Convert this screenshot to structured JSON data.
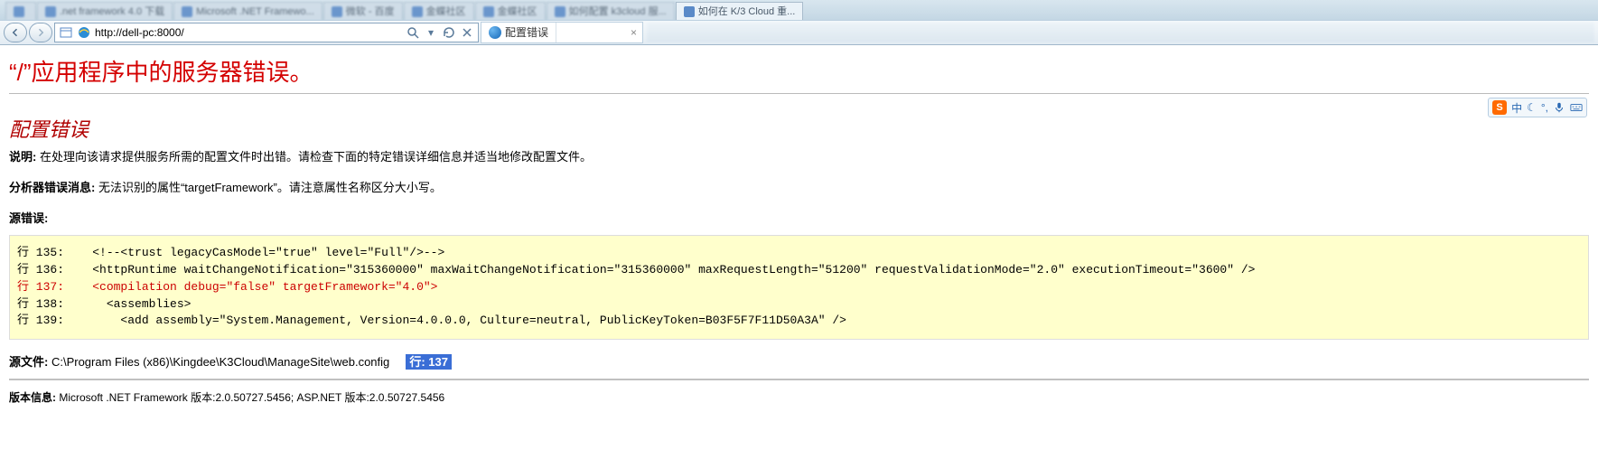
{
  "browser": {
    "tabs": [
      {
        "label": ""
      },
      {
        "label": ".net framework 4.0 下载"
      },
      {
        "label": "Microsoft .NET Framewo..."
      },
      {
        "label": "微软 - 百度"
      },
      {
        "label": "金蝶社区"
      },
      {
        "label": "金蝶社区"
      },
      {
        "label": "如何配置 k3cloud 服..."
      },
      {
        "label": "如何在 K/3 Cloud 重..."
      }
    ],
    "address": "http://dell-pc:8000/",
    "doc_tab_title": "配置错误"
  },
  "ime": {
    "logo": "S",
    "lang": "中",
    "moon": "☾",
    "punct": "°,",
    "mic": "mic",
    "kbd": "kbd"
  },
  "error": {
    "app_title": "“/”应用程序中的服务器错误。",
    "cfg_title": "配置错误",
    "desc_label": "说明:",
    "desc_text": " 在处理向该请求提供服务所需的配置文件时出错。请检查下面的特定错误详细信息并适当地修改配置文件。",
    "parser_label": "分析器错误消息:",
    "parser_text": " 无法识别的属性“targetFramework”。请注意属性名称区分大小写。",
    "src_err_label": "源错误:",
    "code": {
      "l135_prefix": "行 135:    ",
      "l135": "<!--<trust legacyCasModel=\"true\" level=\"Full\"/>-->",
      "l136_prefix": "行 136:    ",
      "l136": "<httpRuntime waitChangeNotification=\"315360000\" maxWaitChangeNotification=\"315360000\" maxRequestLength=\"51200\" requestValidationMode=\"2.0\" executionTimeout=\"3600\" />",
      "l137_prefix": "行 137:    ",
      "l137": "<compilation debug=\"false\" targetFramework=\"4.0\">",
      "l138_prefix": "行 138:      ",
      "l138": "<assemblies>",
      "l139_prefix": "行 139:        ",
      "l139": "<add assembly=\"System.Management, Version=4.0.0.0, Culture=neutral, PublicKeyToken=B03F5F7F11D50A3A\" />"
    },
    "src_file_label": "源文件:",
    "src_file_path": " C:\\Program Files (x86)\\Kingdee\\K3Cloud\\ManageSite\\web.config",
    "line_label": "行:",
    "line_no": " 137",
    "ver_label": "版本信息:",
    "ver_text": " Microsoft .NET Framework 版本:2.0.50727.5456; ASP.NET 版本:2.0.50727.5456"
  }
}
